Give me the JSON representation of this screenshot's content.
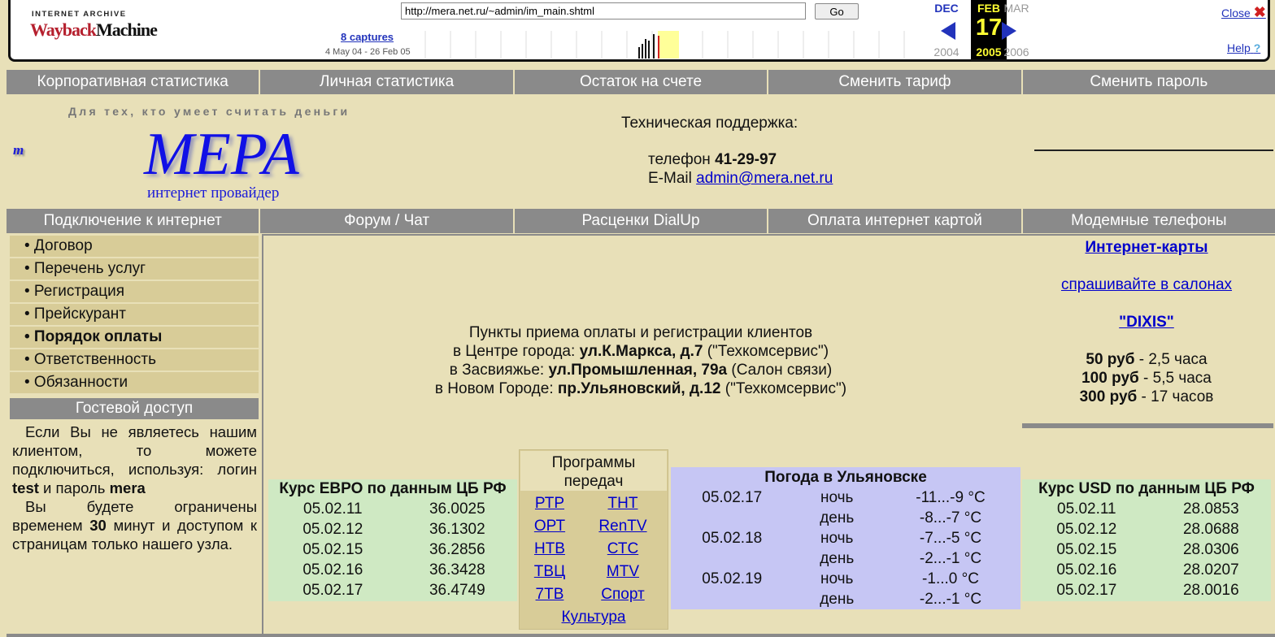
{
  "wayback": {
    "logo_top": "INTERNET ARCHIVE",
    "logo_way": "Wayback",
    "logo_machine": "Machine",
    "url": "http://mera.net.ru/~admin/im_main.shtml",
    "go_label": "Go",
    "captures": "8 captures",
    "range": "4 May 04 - 26 Feb 05",
    "prev_month": "DEC",
    "cur_month": "FEB",
    "next_month": "MAR",
    "cur_day": "17",
    "prev_year": "2004",
    "cur_year": "2005",
    "next_year": "2006",
    "close_label": "Close",
    "help_label": "Help",
    "colors": {
      "accent": "#2233bb",
      "current_day": "#ffff33",
      "logo_red": "#b5202e"
    }
  },
  "top_menu": [
    "Корпоративная статистика",
    "Личная статистика",
    "Остаток на счете",
    "Сменить тариф",
    "Сменить пароль"
  ],
  "header": {
    "tagline": "Для тех, кто умеет считать деньги",
    "logo_small": "m",
    "logo": "МЕРА",
    "logo_sub": "интернет провайдер",
    "support_title": "Техническая поддержка:",
    "phone_label": "телефон",
    "phone": "41-29-97",
    "email_label": "E-Mail",
    "email": "admin@mera.net.ru"
  },
  "second_menu": [
    "Подключение к интернет",
    "Форум / Чат",
    "Расценки DialUp",
    "Оплата интернет картой",
    "Модемные телефоны"
  ],
  "sidebar": {
    "items": [
      {
        "label": "• Договор",
        "bold": false
      },
      {
        "label": "• Перечень услуг",
        "bold": false
      },
      {
        "label": "• Регистрация",
        "bold": false
      },
      {
        "label": "• Прейскурант",
        "bold": false
      },
      {
        "label": "• Порядок оплаты",
        "bold": true
      },
      {
        "label": "• Ответственность",
        "bold": false
      },
      {
        "label": "• Обязанности",
        "bold": false
      }
    ],
    "guest_title": "Гостевой доступ",
    "guest_p1_a": "Если Вы не являетесь нашим клиентом, то можете подключиться, используя: логин",
    "guest_login": "test",
    "guest_p1_b": "и пароль",
    "guest_password": "mera",
    "guest_p2_a": "Вы будете ограничены временем",
    "guest_minutes": "30",
    "guest_p2_b": "минут и доступом к страницам только нашего узла."
  },
  "points": {
    "title": "Пункты приема оплаты и регистрации клиентов",
    "lines": [
      {
        "prefix": "в Центре города:",
        "addr": "ул.К.Маркса, д.7",
        "suffix": "(\"Техкомсервис\")"
      },
      {
        "prefix": "в Засвияжье:",
        "addr": "ул.Промышленная, 79а",
        "suffix": "(Салон связи)"
      },
      {
        "prefix": "в Новом Городе:",
        "addr": "пр.Ульяновский, д.12",
        "suffix": "(\"Техкомсервис\")"
      }
    ]
  },
  "cards": {
    "title": "Интернет-карты",
    "link": "спрашивайте в салонах",
    "dixis": "\"DIXIS\"",
    "prices": [
      {
        "price": "50 руб",
        "desc": "- 2,5 часа"
      },
      {
        "price": "100 руб",
        "desc": "- 5,5 часа"
      },
      {
        "price": "300 руб",
        "desc": "- 17 часов"
      }
    ]
  },
  "euro": {
    "title": "Курс ЕВРО по данным ЦБ РФ",
    "rows": [
      [
        "05.02.11",
        "36.0025"
      ],
      [
        "05.02.12",
        "36.1302"
      ],
      [
        "05.02.15",
        "36.2856"
      ],
      [
        "05.02.16",
        "36.3428"
      ],
      [
        "05.02.17",
        "36.4749"
      ]
    ]
  },
  "usd": {
    "title": "Курс USD по данным ЦБ РФ",
    "rows": [
      [
        "05.02.11",
        "28.0853"
      ],
      [
        "05.02.12",
        "28.0688"
      ],
      [
        "05.02.15",
        "28.0306"
      ],
      [
        "05.02.16",
        "28.0207"
      ],
      [
        "05.02.17",
        "28.0016"
      ]
    ]
  },
  "tv": {
    "title_1": "Программы",
    "title_2": "передач",
    "channels": [
      [
        "РТР",
        "ТНТ"
      ],
      [
        "ОРТ",
        "RenTV"
      ],
      [
        "НТВ",
        "СТС"
      ],
      [
        "ТВЦ",
        "MTV"
      ],
      [
        "7ТВ",
        "Спорт"
      ]
    ],
    "last": "Культура"
  },
  "weather": {
    "title": "Погода в Ульяновске",
    "rows": [
      {
        "date": "05.02.17",
        "time": "ночь",
        "temp": "-11...-9 °C"
      },
      {
        "date": "",
        "time": "день",
        "temp": "-8...-7 °C"
      },
      {
        "date": "05.02.18",
        "time": "ночь",
        "temp": "-7...-5 °C"
      },
      {
        "date": "",
        "time": "день",
        "temp": "-2...-1 °C"
      },
      {
        "date": "05.02.19",
        "time": "ночь",
        "temp": "-1...0 °C"
      },
      {
        "date": "",
        "time": "день",
        "temp": "-2...-1 °C"
      }
    ]
  }
}
